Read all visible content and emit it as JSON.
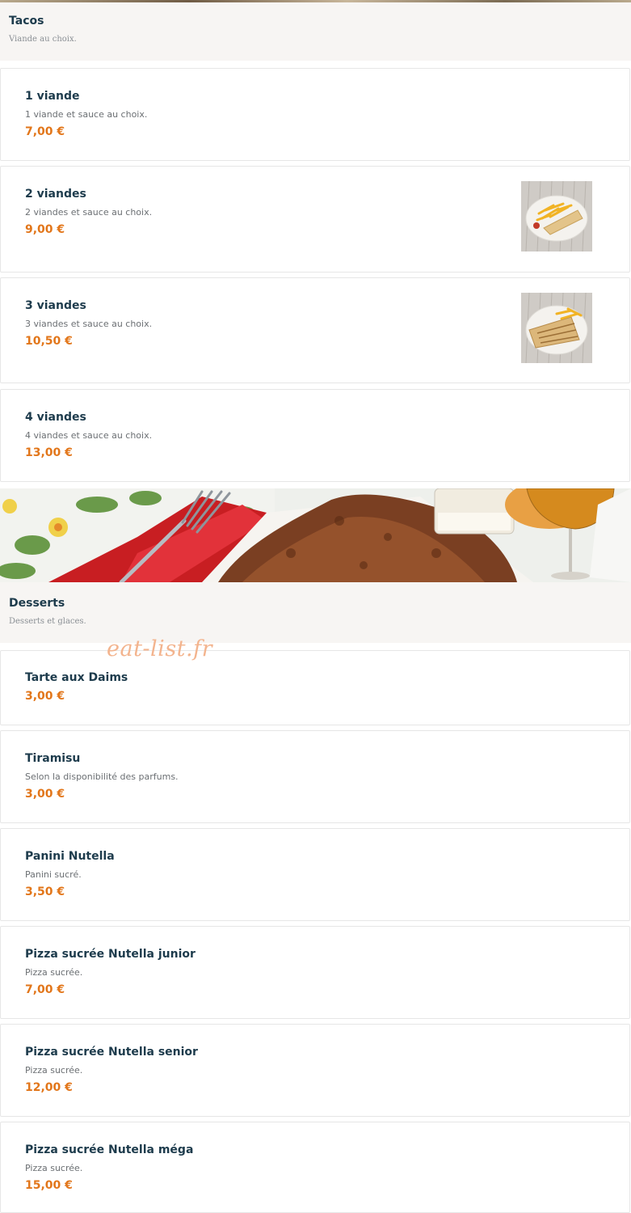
{
  "categories": [
    {
      "title": "Tacos",
      "description": "Viande au choix.",
      "items": [
        {
          "name": "1 viande",
          "description": "1 viande et sauce au choix.",
          "price": "7,00 €"
        },
        {
          "name": "2 viandes",
          "description": "2 viandes et sauce au choix.",
          "price": "9,00 €",
          "photo": "tacos-with-fries-photo"
        },
        {
          "name": "3 viandes",
          "description": "3 viandes et sauce au choix.",
          "price": "10,50 €",
          "photo": "tacos-with-fries-photo"
        },
        {
          "name": "4 viandes",
          "description": "4 viandes et sauce au choix.",
          "price": "13,00 €"
        }
      ]
    },
    {
      "title": "Desserts",
      "description": "Desserts et glaces.",
      "banner": "tiramisu-dessert-photo",
      "items": [
        {
          "name": "Tarte aux Daims",
          "description": "",
          "price": "3,00 €"
        },
        {
          "name": "Tiramisu",
          "description": "Selon la disponibilité des parfums.",
          "price": "3,00 €"
        },
        {
          "name": "Panini Nutella",
          "description": "Panini sucré.",
          "price": "3,50 €"
        },
        {
          "name": "Pizza sucrée Nutella junior",
          "description": "Pizza sucrée.",
          "price": "7,00 €"
        },
        {
          "name": "Pizza sucrée Nutella senior",
          "description": "Pizza sucrée.",
          "price": "12,00 €"
        },
        {
          "name": "Pizza sucrée Nutella méga",
          "description": "Pizza sucrée.",
          "price": "15,00 €"
        }
      ]
    }
  ],
  "watermark": "eat-list.fr",
  "colors": {
    "title": "#1d3b4c",
    "price": "#e2761a",
    "header_bg": "#f7f5f3",
    "watermark": "#f3b48e"
  }
}
